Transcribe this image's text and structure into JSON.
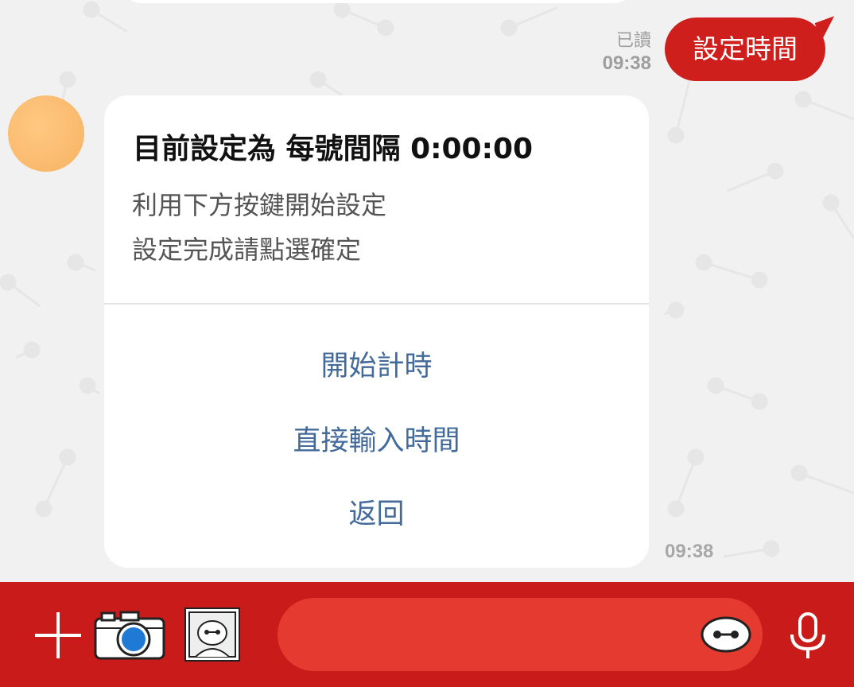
{
  "chat": {
    "sent_message": {
      "text": "設定時間",
      "read_status": "已讀",
      "time": "09:38"
    },
    "bot_card": {
      "title": "目前設定為 每號間隔 0:00:00",
      "body_lines": [
        "利用下方按鍵開始設定",
        "設定完成請點選確定"
      ],
      "actions": [
        "開始計時",
        "直接輸入時間",
        "返回"
      ],
      "time": "09:38"
    }
  },
  "input_bar": {
    "message_placeholder": ""
  },
  "icons": {
    "plus": "plus-icon",
    "camera": "camera-icon",
    "sticker": "sticker-icon",
    "emoji": "emoji-icon",
    "mic": "microphone-icon"
  },
  "colors": {
    "brand_red": "#c91c1a",
    "bubble_red": "#cf1f1d",
    "input_red": "#e43a30",
    "action_blue": "#436a9b",
    "avatar_orange": "#f7b363"
  }
}
